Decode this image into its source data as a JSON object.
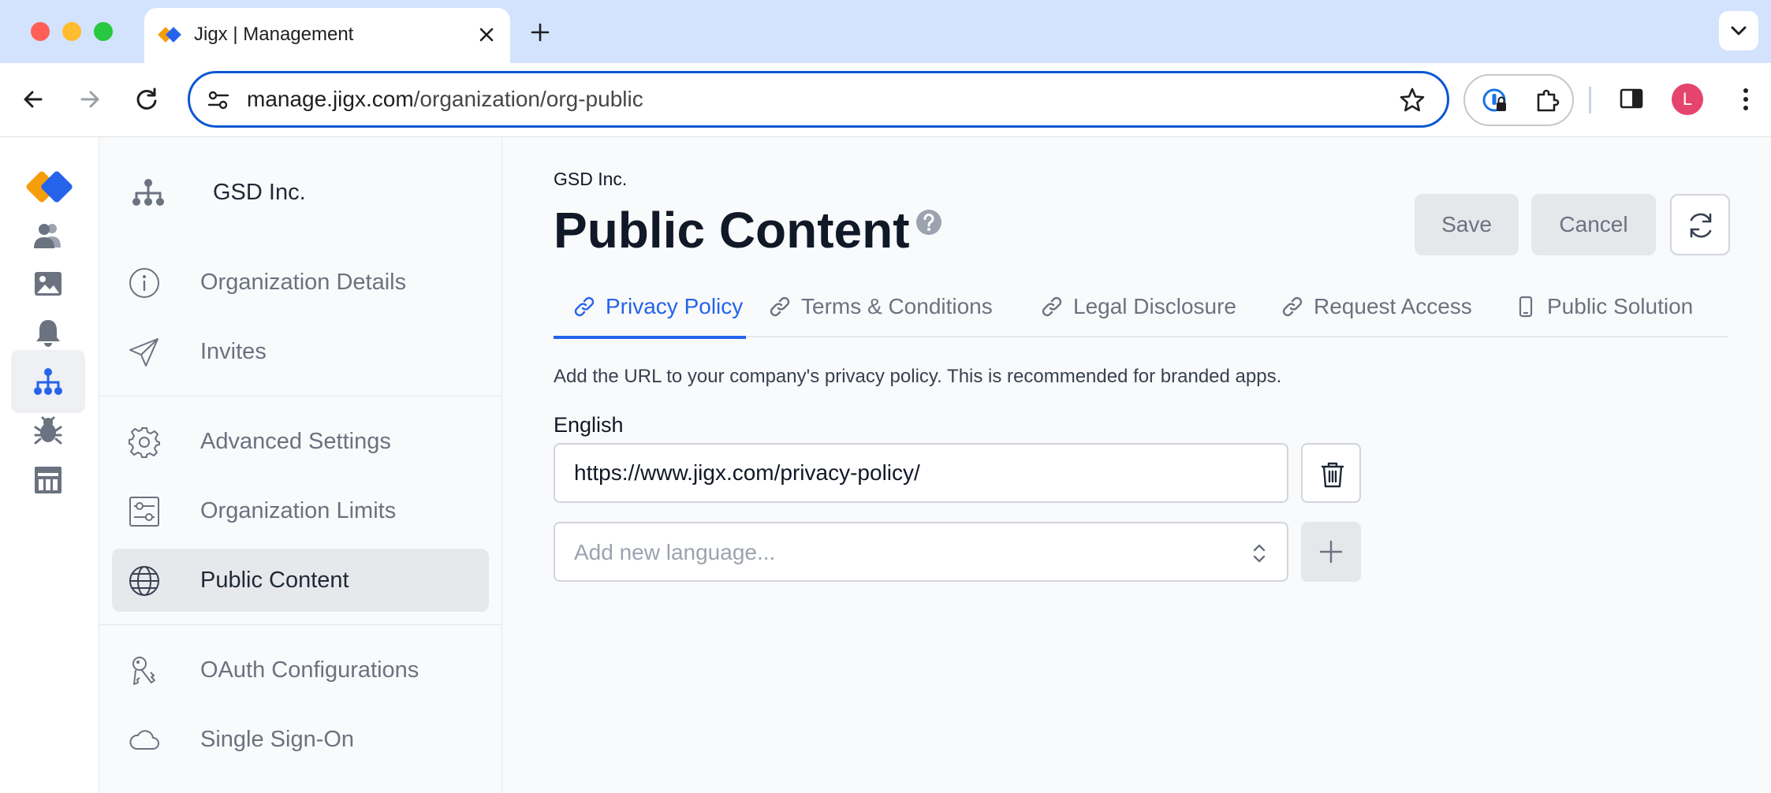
{
  "browser": {
    "tab_title": "Jigx | Management",
    "url_host": "manage.jigx.com",
    "url_path": "/organization/org-public",
    "profile_initial": "L"
  },
  "rail": {
    "items": [
      {
        "icon": "users-icon"
      },
      {
        "icon": "image-icon"
      },
      {
        "icon": "bell-icon"
      },
      {
        "icon": "org-tree-icon",
        "active": true
      },
      {
        "icon": "bug-icon"
      },
      {
        "icon": "library-icon"
      }
    ]
  },
  "subnav": {
    "org_name": "GSD Inc.",
    "items": [
      {
        "label": "Organization Details",
        "icon": "info-icon"
      },
      {
        "label": "Invites",
        "icon": "send-icon"
      },
      {
        "label": "Advanced Settings",
        "icon": "gear-icon"
      },
      {
        "label": "Organization Limits",
        "icon": "sliders-icon"
      },
      {
        "label": "Public Content",
        "icon": "globe-icon",
        "active": true
      },
      {
        "label": "OAuth Configurations",
        "icon": "keys-icon"
      },
      {
        "label": "Single Sign-On",
        "icon": "cloud-icon"
      }
    ]
  },
  "main": {
    "breadcrumb": "GSD Inc.",
    "title": "Public Content",
    "save_label": "Save",
    "cancel_label": "Cancel",
    "tabs": [
      {
        "label": "Privacy Policy",
        "icon": "link-icon",
        "active": true
      },
      {
        "label": "Terms & Conditions",
        "icon": "link-icon"
      },
      {
        "label": "Legal Disclosure",
        "icon": "link-icon"
      },
      {
        "label": "Request Access",
        "icon": "link-icon"
      },
      {
        "label": "Public Solution",
        "icon": "phone-icon"
      }
    ],
    "description": "Add the URL to your company's privacy policy. This is recommended for branded apps.",
    "language_label": "English",
    "url_value": "https://www.jigx.com/privacy-policy/",
    "add_language_placeholder": "Add new language..."
  },
  "colors": {
    "accent": "#2563eb",
    "logo_orange": "#f59e0b",
    "logo_blue": "#2563eb",
    "omnibox_focus": "#0b57d0"
  }
}
